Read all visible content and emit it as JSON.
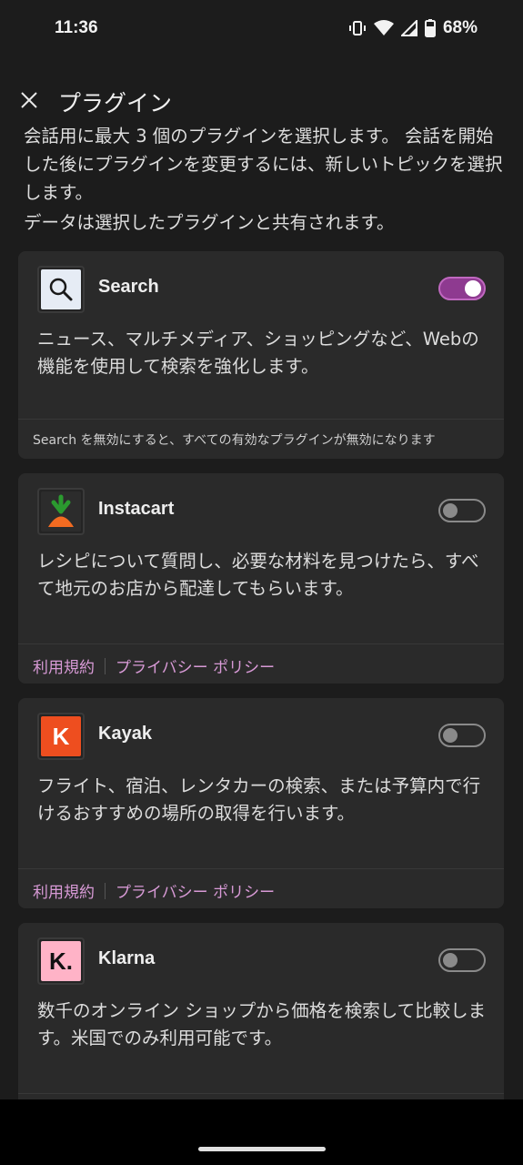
{
  "status": {
    "time": "11:36",
    "battery": "68%"
  },
  "header": {
    "title": "プラグイン"
  },
  "intro": {
    "text": "会話用に最大 3 個のプラグインを選択します。 会話を開始した後にプラグインを変更するには、新しいトピックを選択します。",
    "sharing": "データは選択したプラグインと共有されます。"
  },
  "plugins": [
    {
      "name": "Search",
      "enabled": true,
      "icon": "search-icon",
      "desc": "ニュース、マルチメディア、ショッピングなど、Webの機能を使用して検索を強化します。",
      "note": "Search を無効にすると、すべての有効なプラグインが無効になります"
    },
    {
      "name": "Instacart",
      "enabled": false,
      "icon": "carrot-icon",
      "desc": "レシピについて質問し、必要な材料を見つけたら、すべて地元のお店から配達してもらいます。",
      "terms": "利用規約",
      "privacy": "プライバシー ポリシー"
    },
    {
      "name": "Kayak",
      "enabled": false,
      "icon": "kayak-logo",
      "icon_letter": "K",
      "desc": "フライト、宿泊、レンタカーの検索、または予算内で行けるおすすめの場所の取得を行います。",
      "terms": "利用規約",
      "privacy": "プライバシー ポリシー"
    },
    {
      "name": "Klarna",
      "enabled": false,
      "icon": "klarna-logo",
      "icon_letter": "K.",
      "desc": "数千のオンライン ショップから価格を検索して比較します。米国でのみ利用可能です。"
    }
  ],
  "colors": {
    "accent": "#8e3a90",
    "link": "#d89ad6",
    "kayak": "#ee4e1f",
    "klarna": "#ffb3c7",
    "instacart_green": "#2b9a2f",
    "instacart_orange": "#f26b21"
  }
}
